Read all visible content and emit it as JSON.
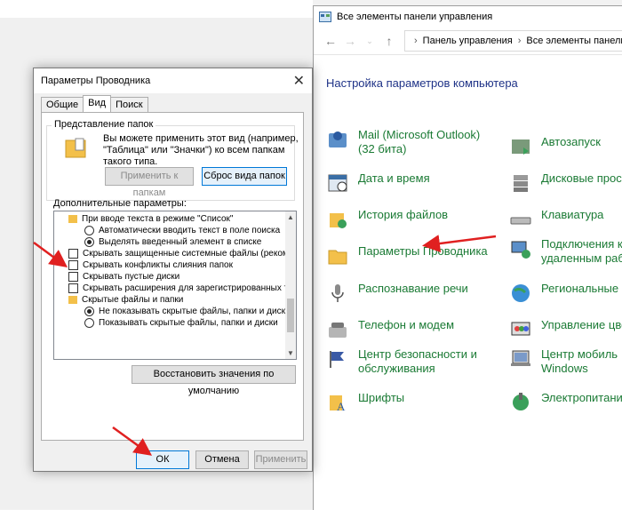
{
  "control_panel": {
    "title": "Все элементы панели управления",
    "breadcrumb": [
      "Панель управления",
      "Все элементы панели упр"
    ],
    "heading": "Настройка параметров компьютера",
    "items": [
      {
        "label": "Mail (Microsoft Outlook)\n(32 бита)",
        "icon": "mail-icon"
      },
      {
        "label": "Автозапуск",
        "icon": "autoplay-icon"
      },
      {
        "label": "Дата и время",
        "icon": "datetime-icon"
      },
      {
        "label": "Дисковые прос",
        "icon": "storage-icon"
      },
      {
        "label": "История файлов",
        "icon": "file-history-icon"
      },
      {
        "label": "Клавиатура",
        "icon": "keyboard-icon"
      },
      {
        "label": "Параметры Проводника",
        "icon": "folder-options-icon"
      },
      {
        "label": "Подключения к\nудаленным раб",
        "icon": "remote-icon"
      },
      {
        "label": "Распознавание речи",
        "icon": "microphone-icon"
      },
      {
        "label": "Региональные с",
        "icon": "globe-icon"
      },
      {
        "label": "Телефон и модем",
        "icon": "phone-icon"
      },
      {
        "label": "Управление цве",
        "icon": "color-icon"
      },
      {
        "label": "Центр безопасности и\nобслуживания",
        "icon": "flag-icon"
      },
      {
        "label": "Центр мобиль\nWindows",
        "icon": "mobility-icon"
      },
      {
        "label": "Шрифты",
        "icon": "fonts-icon"
      },
      {
        "label": "Электропитани",
        "icon": "power-icon"
      }
    ]
  },
  "dialog": {
    "title": "Параметры Проводника",
    "tabs": [
      "Общие",
      "Вид",
      "Поиск"
    ],
    "folder_views_label": "Представление папок",
    "folder_views_text": "Вы можете применить этот вид (например, \"Таблица\" или \"Значки\") ко всем папкам такого типа.",
    "apply_to_folders": "Применить к папкам",
    "reset_folders": "Сброс вида папок",
    "advanced_label": "Дополнительные параметры:",
    "tree": [
      {
        "type": "folder",
        "text": "При вводе текста в режиме \"Список\""
      },
      {
        "type": "radio",
        "checked": false,
        "text": "Автоматически вводить текст в поле поиска"
      },
      {
        "type": "radio",
        "checked": true,
        "text": "Выделять введенный элемент в списке"
      },
      {
        "type": "check",
        "checked": false,
        "text": "Скрывать защищенные системные файлы (рекомен"
      },
      {
        "type": "check",
        "checked": false,
        "text": "Скрывать конфликты слияния папок"
      },
      {
        "type": "check",
        "checked": false,
        "text": "Скрывать пустые диски"
      },
      {
        "type": "check",
        "checked": false,
        "text": "Скрывать расширения для зарегистрированных типо"
      },
      {
        "type": "folder",
        "text": "Скрытые файлы и папки"
      },
      {
        "type": "radio",
        "checked": true,
        "text": "Не показывать скрытые файлы, папки и диски"
      },
      {
        "type": "radio",
        "checked": false,
        "text": "Показывать скрытые файлы, папки и диски"
      }
    ],
    "restore_defaults": "Восстановить значения по умолчанию",
    "ok": "ОК",
    "cancel": "Отмена",
    "apply": "Применить"
  },
  "colors": {
    "link_green": "#1a7a34",
    "heading_blue": "#1e3287",
    "arrow_red": "#e02020"
  }
}
